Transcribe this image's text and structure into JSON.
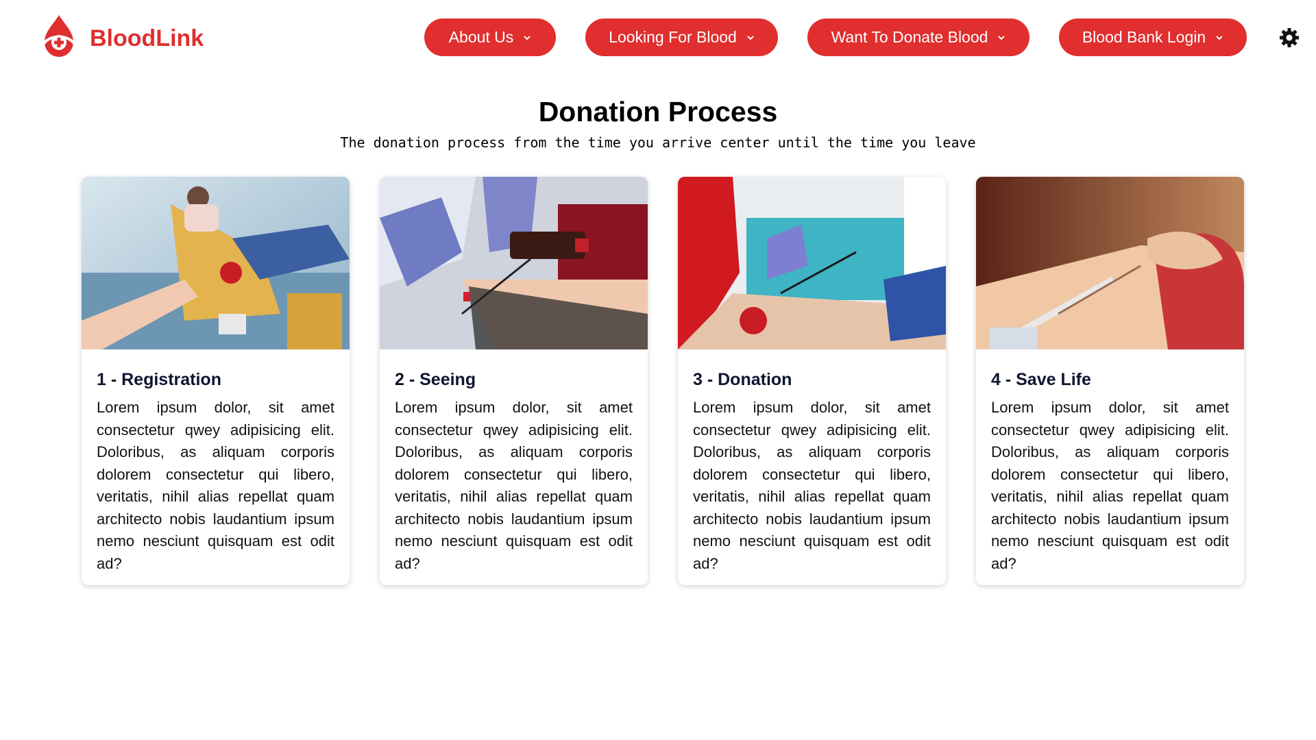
{
  "brand": {
    "name": "BloodLink",
    "accent": "#e12e2e"
  },
  "nav": {
    "items": [
      {
        "label": "About Us"
      },
      {
        "label": "Looking For Blood"
      },
      {
        "label": "Want To Donate Blood"
      },
      {
        "label": "Blood Bank Login"
      }
    ],
    "theme_toggle_icon": "gear-icon"
  },
  "section": {
    "title": "Donation Process",
    "subtitle": "The donation process from the time you arrive center until the time you leave"
  },
  "cards": [
    {
      "title": "1 - Registration",
      "text": "Lorem ipsum dolor, sit amet consectetur qwey adipisicing elit. Doloribus, as aliquam corporis dolorem consectetur qui libero, veritatis, nihil alias repellat quam architecto nobis laudantium ipsum nemo nesciunt quisquam est odit ad?"
    },
    {
      "title": "2 - Seeing",
      "text": "Lorem ipsum dolor, sit amet consectetur qwey adipisicing elit. Doloribus, as aliquam corporis dolorem consectetur qui libero, veritatis, nihil alias repellat quam architecto nobis laudantium ipsum nemo nesciunt quisquam est odit ad?"
    },
    {
      "title": "3 - Donation",
      "text": "Lorem ipsum dolor, sit amet consectetur qwey adipisicing elit. Doloribus, as aliquam corporis dolorem consectetur qui libero, veritatis, nihil alias repellat quam architecto nobis laudantium ipsum nemo nesciunt quisquam est odit ad?"
    },
    {
      "title": "4 - Save Life",
      "text": "Lorem ipsum dolor, sit amet consectetur qwey adipisicing elit. Doloribus, as aliquam corporis dolorem consectetur qui libero, veritatis, nihil alias repellat quam architecto nobis laudantium ipsum nemo nesciunt quisquam est odit ad?"
    }
  ]
}
